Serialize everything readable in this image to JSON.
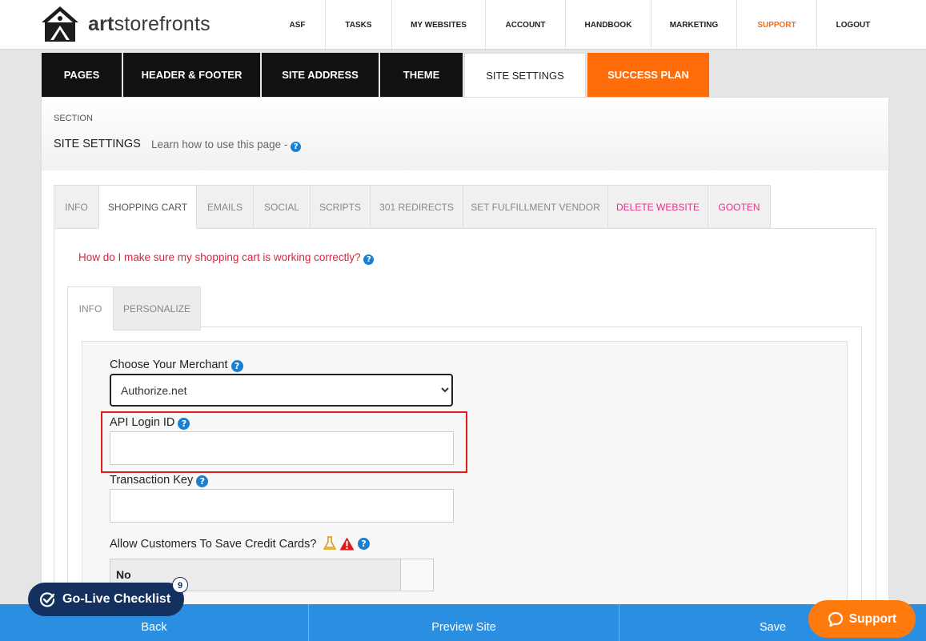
{
  "brand": {
    "logo_bold": "art",
    "logo_rest": "storefronts"
  },
  "topnav": [
    {
      "label": "ASF",
      "width": 70
    },
    {
      "label": "TASKS",
      "width": 83
    },
    {
      "label": "MY WEBSITES",
      "width": 117
    },
    {
      "label": "ACCOUNT",
      "width": 100
    },
    {
      "label": "HANDBOOK",
      "width": 107
    },
    {
      "label": "MARKETING",
      "width": 107
    },
    {
      "label": "SUPPORT",
      "width": 100
    },
    {
      "label": "LOGOUT",
      "width": 90
    }
  ],
  "main_tabs": [
    {
      "label": "PAGES"
    },
    {
      "label": "HEADER & FOOTER"
    },
    {
      "label": "SITE ADDRESS"
    },
    {
      "label": "THEME"
    },
    {
      "label": "SITE SETTINGS"
    },
    {
      "label": "SUCCESS PLAN"
    }
  ],
  "section": {
    "eyebrow": "SECTION",
    "title": "SITE SETTINGS",
    "learn_link": "Learn how to use this page - "
  },
  "sub_tabs": [
    {
      "label": "INFO"
    },
    {
      "label": "SHOPPING CART"
    },
    {
      "label": "EMAILS"
    },
    {
      "label": "SOCIAL"
    },
    {
      "label": "SCRIPTS"
    },
    {
      "label": "301 REDIRECTS"
    },
    {
      "label": "SET FULFILLMENT VENDOR"
    },
    {
      "label": "DELETE WEBSITE"
    },
    {
      "label": "GOOTEN"
    }
  ],
  "help_text": "How do I make sure my shopping cart is working correctly? ",
  "inner_tabs": [
    {
      "label": "INFO"
    },
    {
      "label": "PERSONALIZE"
    }
  ],
  "form": {
    "merchant_label": "Choose Your Merchant ",
    "merchant_value": "Authorize.net",
    "api_login_label": "API Login ID ",
    "api_login_value": "",
    "transaction_key_label": "Transaction Key ",
    "transaction_key_value": "",
    "save_cards_label": "Allow Customers To Save Credit Cards? ",
    "save_cards_value": "No"
  },
  "bottom_bar": {
    "back": "Back",
    "preview": "Preview Site",
    "save": "Save"
  },
  "golive": {
    "label": "Go-Live Checklist",
    "badge": "9"
  },
  "support_button": "Support",
  "colors": {
    "accent_orange": "#ff6d0a",
    "bottom_bar_blue": "#2a8fe0",
    "highlight_red": "#e01b1b",
    "navy": "#13305f"
  }
}
